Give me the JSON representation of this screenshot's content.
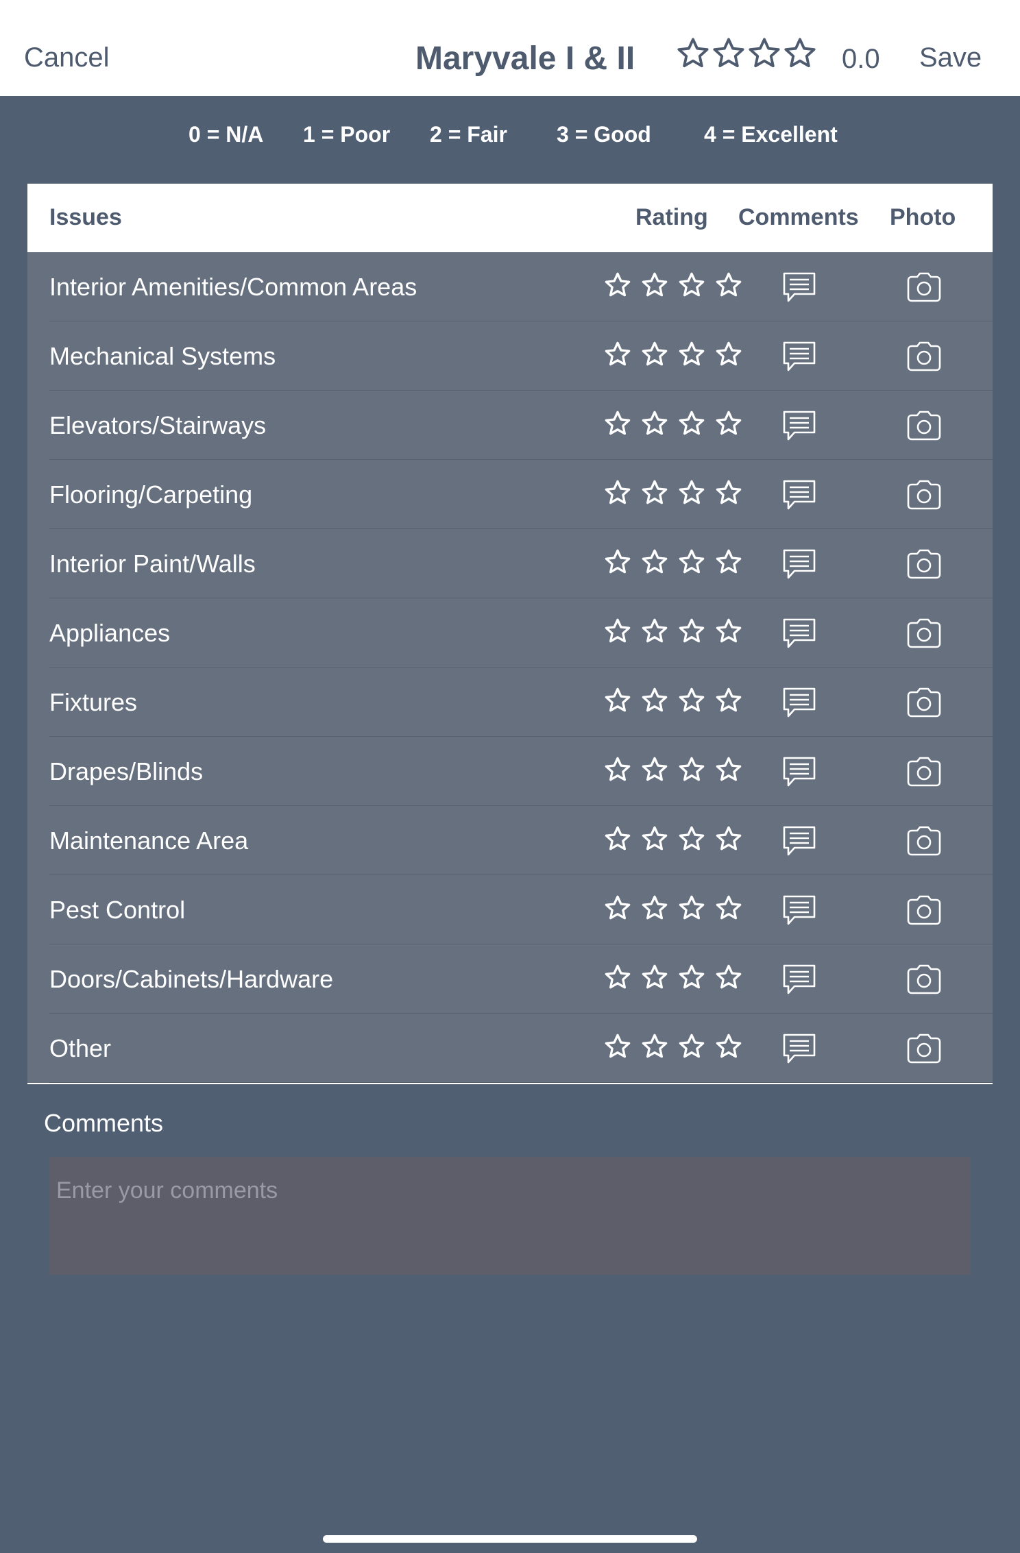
{
  "header": {
    "cancel_label": "Cancel",
    "title": "Maryvale I & II",
    "overall_rating": "0.0",
    "overall_stars": 0,
    "save_label": "Save"
  },
  "legend": [
    "0 = N/A",
    "1 = Poor",
    "2 = Fair",
    "3 = Good",
    "4 = Excellent"
  ],
  "table": {
    "columns": {
      "issues": "Issues",
      "rating": "Rating",
      "comments": "Comments",
      "photo": "Photo"
    },
    "rows": [
      {
        "issue": "Interior Amenities/Common Areas",
        "rating": 0
      },
      {
        "issue": "Mechanical Systems",
        "rating": 0
      },
      {
        "issue": "Elevators/Stairways",
        "rating": 0
      },
      {
        "issue": "Flooring/Carpeting",
        "rating": 0
      },
      {
        "issue": "Interior Paint/Walls",
        "rating": 0
      },
      {
        "issue": "Appliances",
        "rating": 0
      },
      {
        "issue": "Fixtures",
        "rating": 0
      },
      {
        "issue": "Drapes/Blinds",
        "rating": 0
      },
      {
        "issue": "Maintenance Area",
        "rating": 0
      },
      {
        "issue": "Pest Control",
        "rating": 0
      },
      {
        "issue": "Doors/Cabinets/Hardware",
        "rating": 0
      },
      {
        "issue": "Other",
        "rating": 0
      }
    ]
  },
  "comments": {
    "label": "Comments",
    "placeholder": "Enter your comments",
    "value": ""
  },
  "icons": {
    "star": "star-outline-icon",
    "comment": "comment-icon",
    "photo": "camera-icon"
  },
  "colors": {
    "background": "#515f73",
    "row_background": "#66707f",
    "header_text": "#4e5b6f",
    "comments_box": "#5e5d6a"
  }
}
